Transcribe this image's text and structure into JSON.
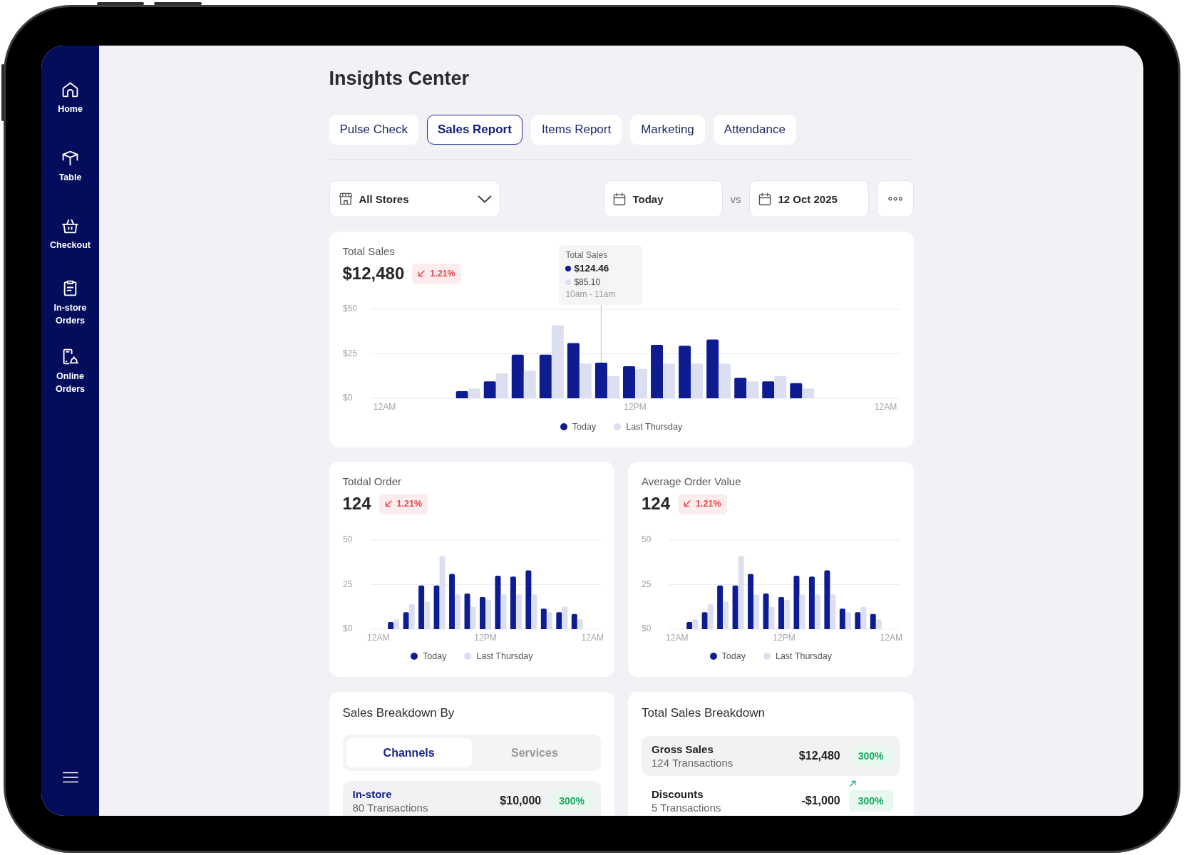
{
  "sidebar": {
    "items": [
      {
        "label": "Home"
      },
      {
        "label": "Table"
      },
      {
        "label": "Checkout"
      },
      {
        "label": "In-store Orders"
      },
      {
        "label": "Online Orders"
      }
    ]
  },
  "page": {
    "title": "Insights Center"
  },
  "tabs": [
    {
      "label": "Pulse Check",
      "selected": false
    },
    {
      "label": "Sales Report",
      "selected": true
    },
    {
      "label": "Items Report",
      "selected": false
    },
    {
      "label": "Marketing",
      "selected": false
    },
    {
      "label": "Attendance",
      "selected": false
    }
  ],
  "filters": {
    "store": "All Stores",
    "date": "Today",
    "compare_label": "vs",
    "compare_date": "12 Oct 2025"
  },
  "total_sales": {
    "title": "Total Sales",
    "value": "$12,480",
    "change": "1.21%",
    "positive": false,
    "tooltip": {
      "title": "Total Sales",
      "rows": [
        {
          "value": "$124.46",
          "color": "#0d1c91",
          "emphasized": true
        },
        {
          "value": "$85.10",
          "color": "#dcdff0",
          "emphasized": false
        }
      ],
      "time": "10am - 11am"
    },
    "chart_data": {
      "type": "bar",
      "categories": [
        "12AM",
        null,
        null,
        null,
        null,
        null,
        null,
        null,
        null,
        "12PM",
        null,
        null,
        null,
        null,
        null,
        null,
        null,
        null,
        "12AM"
      ],
      "ylim": [
        0,
        50
      ],
      "yticks": [
        {
          "value": 0,
          "label": "$0"
        },
        {
          "value": 25,
          "label": "$25"
        },
        {
          "value": 50,
          "label": "$50"
        }
      ],
      "legend": "bottom",
      "series": [
        {
          "name": "Today",
          "color": "#0d1c91",
          "values": [
            null,
            null,
            null,
            4,
            9.5,
            24.5,
            24.5,
            31,
            20,
            18,
            30,
            29.5,
            33,
            11.5,
            9.5,
            8.5,
            null,
            null,
            null
          ]
        },
        {
          "name": "Last Thursday",
          "color": "#dcdff0",
          "values": [
            null,
            null,
            null,
            5.5,
            14,
            15.5,
            41,
            19.5,
            12.5,
            16.5,
            19.5,
            19.5,
            19.5,
            9.5,
            12.5,
            5.5,
            null,
            null,
            null
          ]
        }
      ]
    }
  },
  "metrics": [
    {
      "title": "Totdal Order",
      "value": "124",
      "change": "1.21%",
      "positive": false,
      "chart_data": {
        "type": "bar",
        "categories": [
          "12AM",
          null,
          null,
          null,
          null,
          null,
          null,
          "12PM",
          null,
          null,
          null,
          null,
          null,
          null,
          "12AM"
        ],
        "ylim": [
          0,
          50
        ],
        "yticks": [
          {
            "value": 0,
            "label": "$0"
          },
          {
            "value": 25,
            "label": "25"
          },
          {
            "value": 50,
            "label": "50"
          }
        ],
        "legend": "bottom",
        "series": [
          {
            "name": "Today",
            "color": "#0d1c91",
            "values": [
              null,
              4,
              9.5,
              24.5,
              24.5,
              31,
              20,
              18,
              30,
              29.5,
              33,
              11.5,
              9.5,
              8.5,
              null
            ]
          },
          {
            "name": "Last Thursday",
            "color": "#dcdff0",
            "values": [
              null,
              5.5,
              14,
              15.5,
              41,
              19.5,
              12.5,
              16.5,
              19.5,
              19.5,
              19.5,
              9.5,
              12.5,
              5.5,
              null
            ]
          }
        ]
      }
    },
    {
      "title": "Average Order Value",
      "value": "124",
      "change": "1.21%",
      "positive": false,
      "chart_data": {
        "type": "bar",
        "categories": [
          "12AM",
          null,
          null,
          null,
          null,
          null,
          null,
          "12PM",
          null,
          null,
          null,
          null,
          null,
          null,
          "12AM"
        ],
        "ylim": [
          0,
          50
        ],
        "yticks": [
          {
            "value": 0,
            "label": "$0"
          },
          {
            "value": 25,
            "label": "25"
          },
          {
            "value": 50,
            "label": "50"
          }
        ],
        "legend": "bottom",
        "series": [
          {
            "name": "Today",
            "color": "#0d1c91",
            "values": [
              null,
              4,
              9.5,
              24.5,
              24.5,
              31,
              20,
              18,
              30,
              29.5,
              33,
              11.5,
              9.5,
              8.5,
              null
            ]
          },
          {
            "name": "Last Thursday",
            "color": "#dcdff0",
            "values": [
              null,
              5.5,
              14,
              15.5,
              41,
              19.5,
              12.5,
              16.5,
              19.5,
              19.5,
              19.5,
              9.5,
              12.5,
              5.5,
              null
            ]
          }
        ]
      }
    }
  ],
  "sales_breakdown": {
    "title": "Sales Breakdown By",
    "tabs": [
      {
        "label": "Channels",
        "selected": true
      },
      {
        "label": "Services",
        "selected": false
      }
    ],
    "rows": [
      {
        "name": "In-store",
        "transactions": "80 Transactions",
        "amount": "$10,000",
        "change": "300%",
        "positive": true,
        "arrow": false,
        "selected": true
      }
    ]
  },
  "total_sales_breakdown": {
    "title": "Total Sales Breakdown",
    "rows": [
      {
        "name": "Gross Sales",
        "transactions": "124 Transactions",
        "amount": "$12,480",
        "change": "300%",
        "positive": true,
        "arrow": true,
        "selected": true
      },
      {
        "name": "Discounts",
        "transactions": "5 Transactions",
        "amount": "-$1,000",
        "change": "300%",
        "positive": true,
        "arrow": false,
        "selected": false
      }
    ]
  }
}
